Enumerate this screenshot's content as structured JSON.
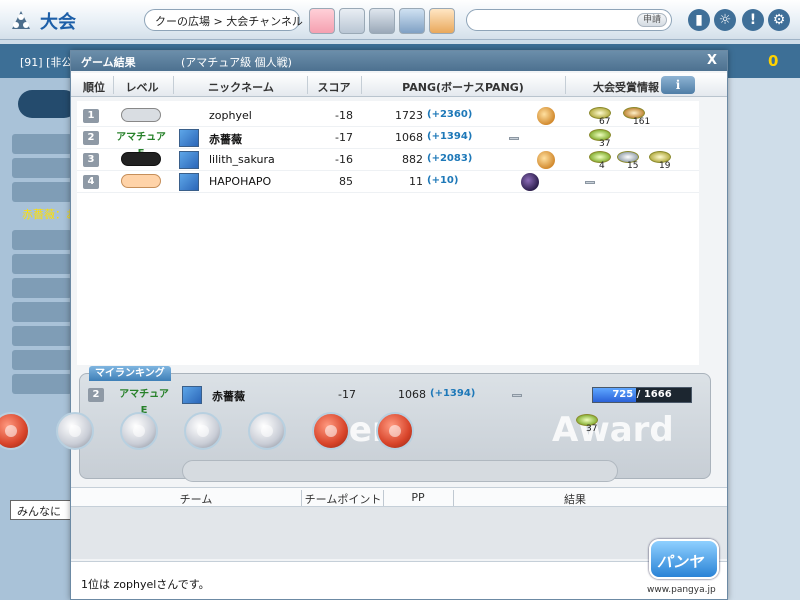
{
  "topbar": {
    "title": "大会",
    "breadcrumb": "クーの広場 > 大会チャンネル",
    "search_button": "申請",
    "icons": [
      "phone-icon",
      "users-gear-icon",
      "alert-icon",
      "settings-gear-icon"
    ]
  },
  "background": {
    "room_label": "[91] [非公",
    "points": "0",
    "left_red_text": "赤薔薇：お",
    "chat_all": "みんなに"
  },
  "modal": {
    "title": "ゲーム結果",
    "subtitle": "(アマチュア級 個人戦)",
    "close": "X",
    "columns": {
      "rank": "順位",
      "level": "レベル",
      "nickname": "ニックネーム",
      "score": "スコア",
      "pang": "PANG(ボーナスPANG)",
      "award": "大会受賞情報",
      "info": "i"
    },
    "rows": [
      {
        "rank": "1",
        "level": "",
        "level_icon": "wings-icon",
        "nickname": "zophyel",
        "score": "-18",
        "pang": "1723",
        "bonus": "(+2360)",
        "item": "golfer-icon",
        "awards": [
          {
            "count": "67"
          },
          {
            "count": "161"
          }
        ]
      },
      {
        "rank": "2",
        "level": "アマチュアE",
        "level_icon": "",
        "nickname": "赤薔薇",
        "score": "-17",
        "pang": "1068",
        "bonus": "(+1394)",
        "item": "dash",
        "awards": [
          {
            "count": "37"
          }
        ]
      },
      {
        "rank": "3",
        "level": "",
        "level_icon": "dark-pair-icon",
        "nickname": "lilith_sakura",
        "score": "-16",
        "pang": "882",
        "bonus": "(+2083)",
        "item": "golfer-icon",
        "awards": [
          {
            "count": "4"
          },
          {
            "count": "15"
          },
          {
            "count": "19"
          }
        ]
      },
      {
        "rank": "4",
        "level": "",
        "level_icon": "smile-pair-icon",
        "nickname": "HAPOHAPO",
        "score": "85",
        "pang": "11",
        "bonus": "(+10)",
        "item": "ghost-icon",
        "awards": []
      }
    ],
    "my_ranking": {
      "tab_label": "マイランキング",
      "rank": "2",
      "level": "アマチュアE",
      "nickname": "赤薔薇",
      "score": "-17",
      "pang": "1068",
      "bonus": "(+1394)",
      "progress_current": "725",
      "progress_max": "1666",
      "progress_fraction": 0.435,
      "progress_label": "725 / 1666",
      "award_count": "37",
      "watermark_left": "Item",
      "watermark_right": "Award"
    },
    "team_columns": {
      "team": "チーム",
      "team_points": "チームポイント",
      "pp": "PP",
      "result": "結果"
    },
    "status_message": "1位は zophyelさんです。",
    "game_logo": "パンヤ",
    "site_url": "www.pangya.jp"
  }
}
